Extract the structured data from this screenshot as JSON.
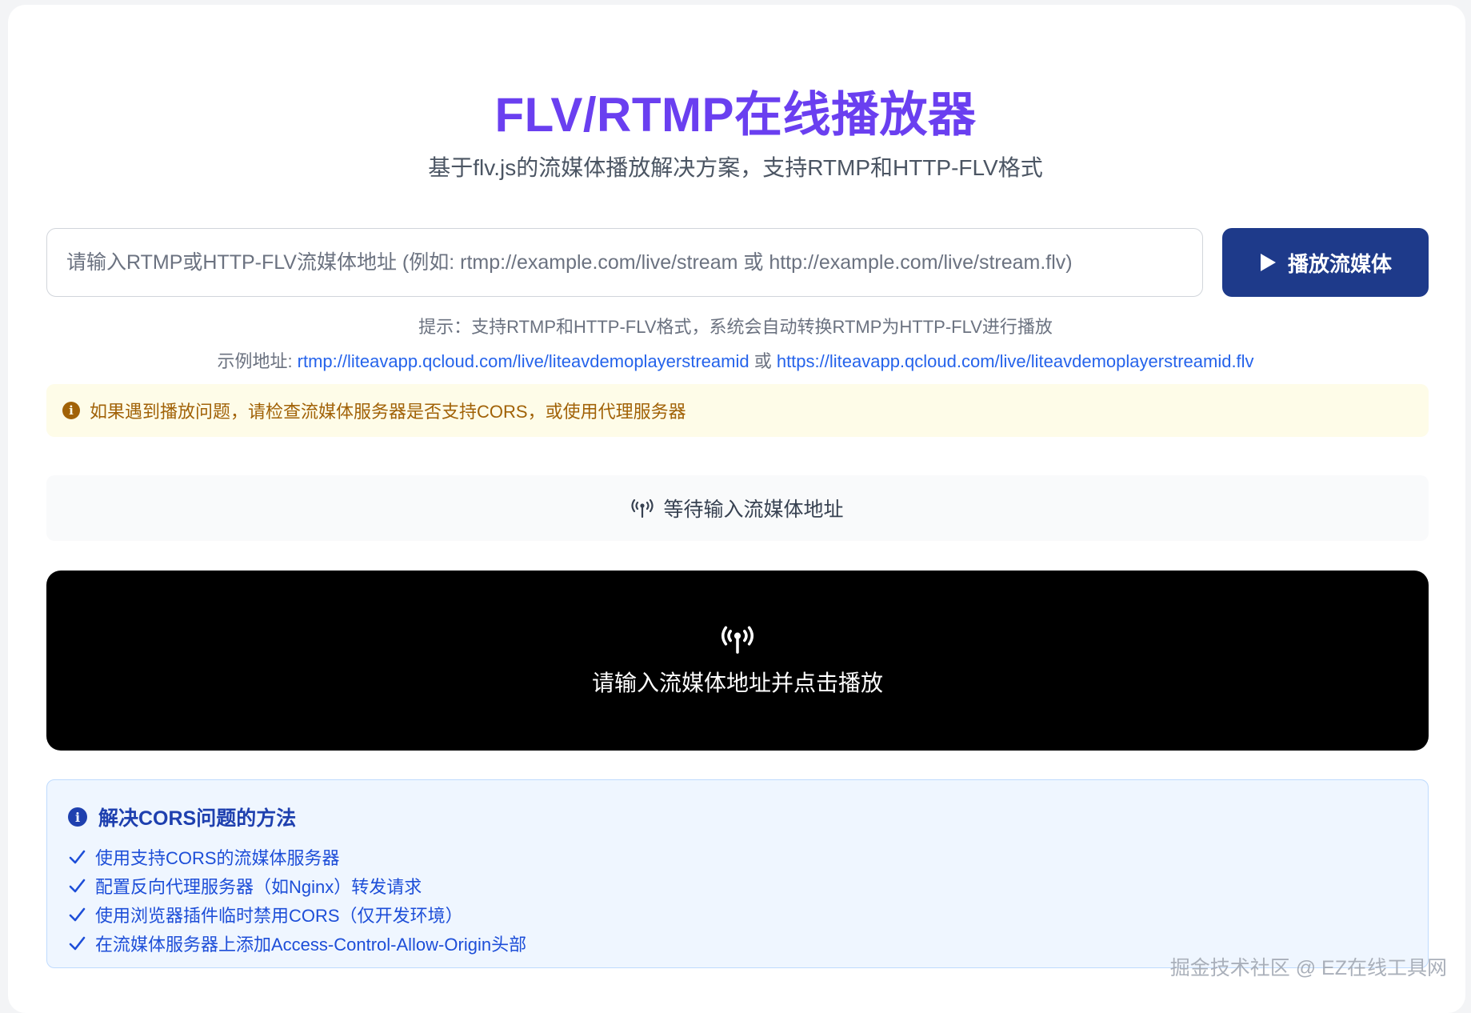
{
  "header": {
    "title": "FLV/RTMP在线播放器",
    "subtitle": "基于flv.js的流媒体播放解决方案，支持RTMP和HTTP-FLV格式"
  },
  "input": {
    "placeholder": "请输入RTMP或HTTP-FLV流媒体地址 (例如: rtmp://example.com/live/stream 或 http://example.com/live/stream.flv)",
    "value": ""
  },
  "play_button": {
    "label": "播放流媒体",
    "icon": "play-icon"
  },
  "hint": "提示：支持RTMP和HTTP-FLV格式，系统会自动转换RTMP为HTTP-FLV进行播放",
  "example": {
    "prefix": "示例地址: ",
    "link1": "rtmp://liteavapp.qcloud.com/live/liteavdemoplayerstreamid",
    "separator": " 或 ",
    "link2": "https://liteavapp.qcloud.com/live/liteavdemoplayerstreamid.flv"
  },
  "warning": {
    "icon": "info-icon",
    "text": "如果遇到播放问题，请检查流媒体服务器是否支持CORS，或使用代理服务器"
  },
  "status": {
    "icon": "broadcast-icon",
    "text": "等待输入流媒体地址"
  },
  "player": {
    "icon": "broadcast-icon",
    "message": "请输入流媒体地址并点击播放"
  },
  "cors_info": {
    "title": "解决CORS问题的方法",
    "items": [
      "使用支持CORS的流媒体服务器",
      "配置反向代理服务器（如Nginx）转发请求",
      "使用浏览器插件临时禁用CORS（仅开发环境）",
      "在流媒体服务器上添加Access-Control-Allow-Origin头部"
    ]
  },
  "watermark": "掘金技术社区 @ EZ在线工具网",
  "colors": {
    "title": "#6a3ff0",
    "button": "#1e3a8a",
    "link": "#2563eb",
    "warning_bg": "#fefce8",
    "warning_text": "#a16207",
    "info_bg": "#eff6ff",
    "info_text": "#1d4ed8"
  }
}
